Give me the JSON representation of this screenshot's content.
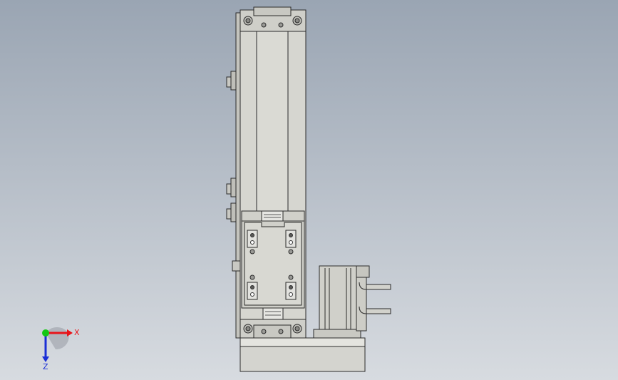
{
  "viewport": {
    "background_top": "#9aa5b3",
    "background_bottom": "#d7dbe0",
    "model_fill": "#d2d2cc",
    "model_stroke": "#2b2b2b"
  },
  "triad": {
    "x_label": "X",
    "z_label": "Z",
    "x_color": "#e8141a",
    "y_color": "#14c814",
    "z_color": "#1a2fd6"
  }
}
